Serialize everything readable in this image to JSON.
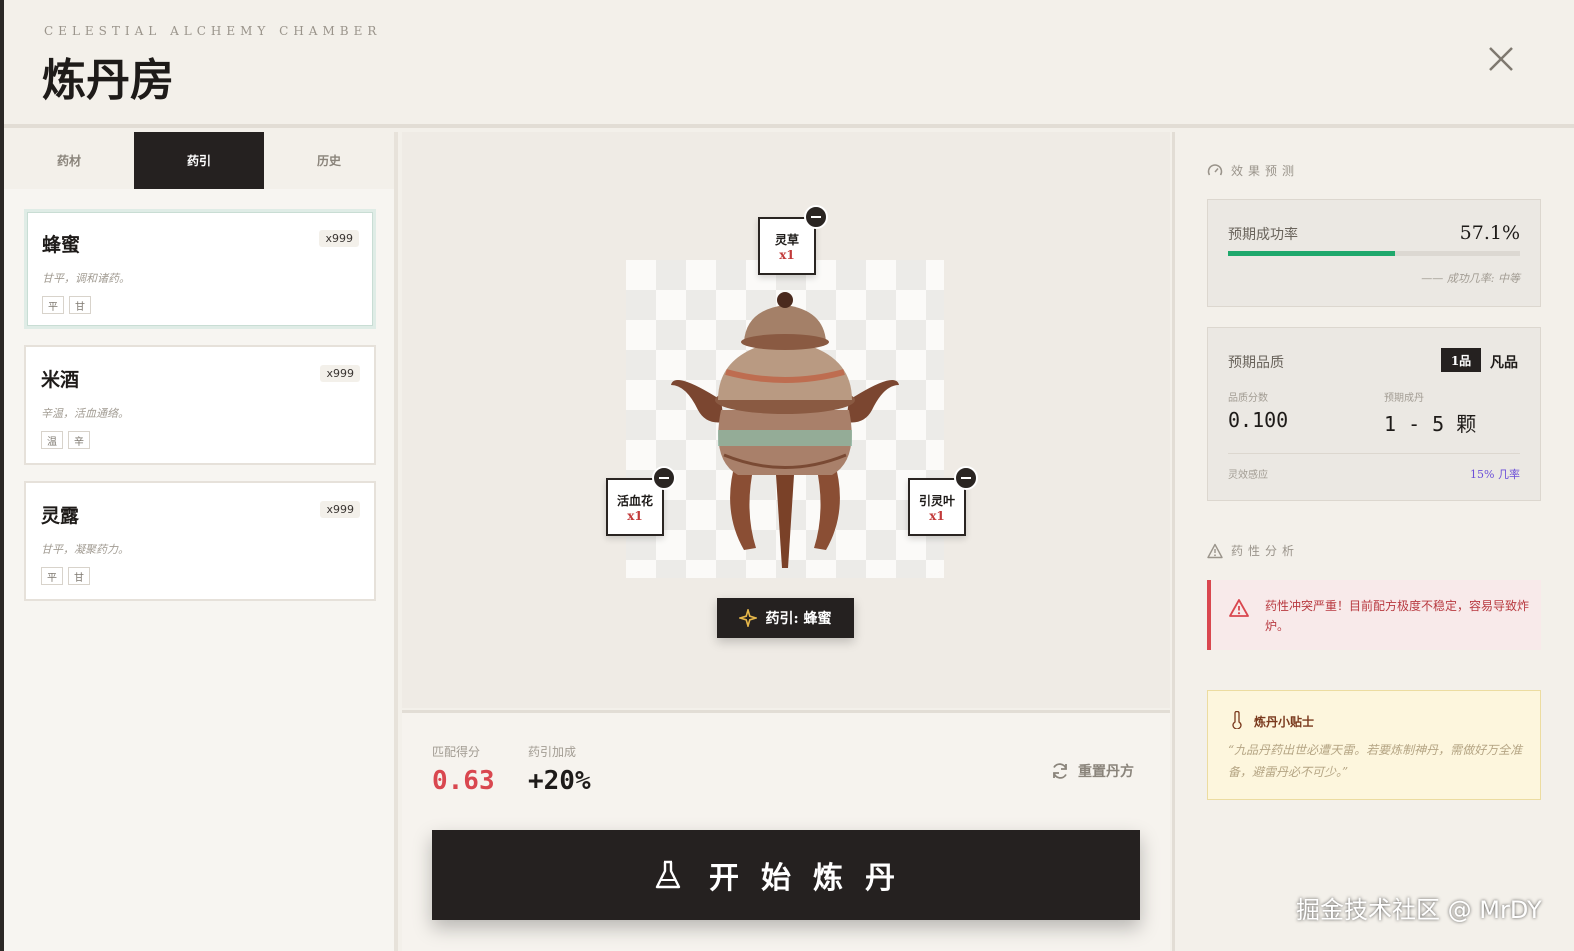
{
  "header": {
    "subtitle": "CELESTIAL ALCHEMY CHAMBER",
    "title": "炼丹房"
  },
  "tabs": [
    {
      "label": "药材"
    },
    {
      "label": "药引"
    },
    {
      "label": "历史"
    }
  ],
  "items": [
    {
      "name": "蜂蜜",
      "count": "x999",
      "desc": "甘平，调和诸药。",
      "tags": [
        "平",
        "甘"
      ]
    },
    {
      "name": "米酒",
      "count": "x999",
      "desc": "辛温，活血通络。",
      "tags": [
        "温",
        "辛"
      ]
    },
    {
      "name": "灵露",
      "count": "x999",
      "desc": "甘平，凝聚药力。",
      "tags": [
        "平",
        "甘"
      ]
    }
  ],
  "cauldron": {
    "slots": [
      {
        "name": "灵草",
        "qty": "x1"
      },
      {
        "name": "活血花",
        "qty": "x1"
      },
      {
        "name": "引灵叶",
        "qty": "x1"
      }
    ],
    "guide_label": "药引: 蜂蜜"
  },
  "stats": {
    "match_label": "匹配得分",
    "match_value": "0.63",
    "bonus_label": "药引加成",
    "bonus_value": "+20%",
    "reset_label": "重置丹方"
  },
  "start_button": "开始炼丹",
  "effect": {
    "section_title": "效果预测",
    "success_label": "预期成功率",
    "success_value": "57.1%",
    "success_fraction": 0.571,
    "success_note": "—— 成功几率: 中等",
    "quality_label": "预期品质",
    "grade_pill": "1品",
    "grade_name": "凡品",
    "score_label": "品质分数",
    "score_value": "0.100",
    "yield_label": "预期成丹",
    "yield_value": "1 - 5 颗",
    "spirit_label": "灵效感应",
    "spirit_value": "15% 几率"
  },
  "analysis": {
    "section_title": "药性分析",
    "alert_text": "药性冲突严重！目前配方极度不稳定，容易导致炸炉。"
  },
  "tip": {
    "title": "炼丹小贴士",
    "quote": "“九品丹药出世必遭天雷。若要炼制神丹，需做好万全准备，避雷丹必不可少。”"
  },
  "watermark": "掘金技术社区 @ MrDY",
  "colors": {
    "accent_dark": "#252120",
    "success_green": "#1fa86c",
    "danger_red": "#d9474f",
    "score_red": "#d9474f",
    "spirit_purple": "#6c4fd8"
  }
}
